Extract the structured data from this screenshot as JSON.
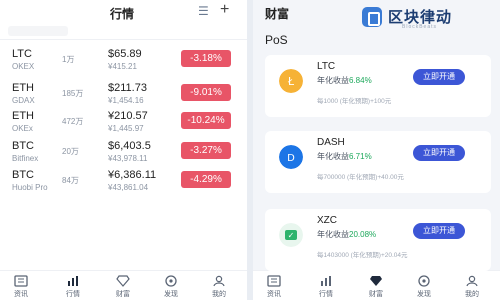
{
  "market": {
    "title": "行情",
    "filter_icon": "filter-icon",
    "add_icon": "plus-icon",
    "rows": [
      {
        "symbol": "LTC",
        "sub": "OKEX",
        "volume": "1万",
        "price": "$65.89",
        "cny": "¥415.21",
        "change": "-3.18%"
      },
      {
        "symbol": "ETH",
        "sub": "GDAX",
        "volume": "185万",
        "price": "$211.73",
        "cny": "¥1,454.16",
        "change": "-9.01%"
      },
      {
        "symbol": "ETH",
        "sub": "OKEx",
        "volume": "472万",
        "price": "¥210.57",
        "cny": "¥1,445.97",
        "change": "-10.24%"
      },
      {
        "symbol": "BTC",
        "sub": "Bitfinex",
        "volume": "20万",
        "price": "$6,403.5",
        "cny": "¥43,978.11",
        "change": "-3.27%"
      },
      {
        "symbol": "BTC",
        "sub": "Huobi Pro",
        "volume": "84万",
        "price": "¥6,386.11",
        "cny": "¥43,861.04",
        "change": "-4.29%"
      }
    ],
    "change_color": "#e85567"
  },
  "wallet": {
    "title": "财富",
    "section": "PoS",
    "brand": {
      "name": "区块律动",
      "tagline": "BlockBeats"
    },
    "cards": [
      {
        "name": "LTC",
        "rate_label": "年化收益",
        "rate": "6.84%",
        "min": "每1000 (年化预期)+100元",
        "button": "立即开通",
        "color": "#f6b236"
      },
      {
        "name": "DASH",
        "rate_label": "年化收益",
        "rate": "6.71%",
        "min": "每700000 (年化预期)+40.00元",
        "button": "立即开通",
        "color": "#1c75e6"
      },
      {
        "name": "XZC",
        "rate_label": "年化收益",
        "rate": "20.08%",
        "min": "每1403000 (年化预期)+20.04元",
        "button": "立即开通",
        "color": "#2eb46d"
      }
    ],
    "button_color": "#3c56d6",
    "rate_color": "#1da85b"
  },
  "nav": {
    "left": [
      {
        "label": "资讯",
        "icon": "news-icon"
      },
      {
        "label": "行情",
        "icon": "chart-icon"
      },
      {
        "label": "财富",
        "icon": "diamond-icon"
      },
      {
        "label": "发现",
        "icon": "discover-icon"
      },
      {
        "label": "我的",
        "icon": "profile-icon"
      }
    ],
    "right": [
      {
        "label": "资讯",
        "icon": "news-icon"
      },
      {
        "label": "行情",
        "icon": "chart-icon"
      },
      {
        "label": "财富",
        "icon": "diamond-icon"
      },
      {
        "label": "发现",
        "icon": "discover-icon"
      },
      {
        "label": "我的",
        "icon": "profile-icon"
      }
    ]
  }
}
